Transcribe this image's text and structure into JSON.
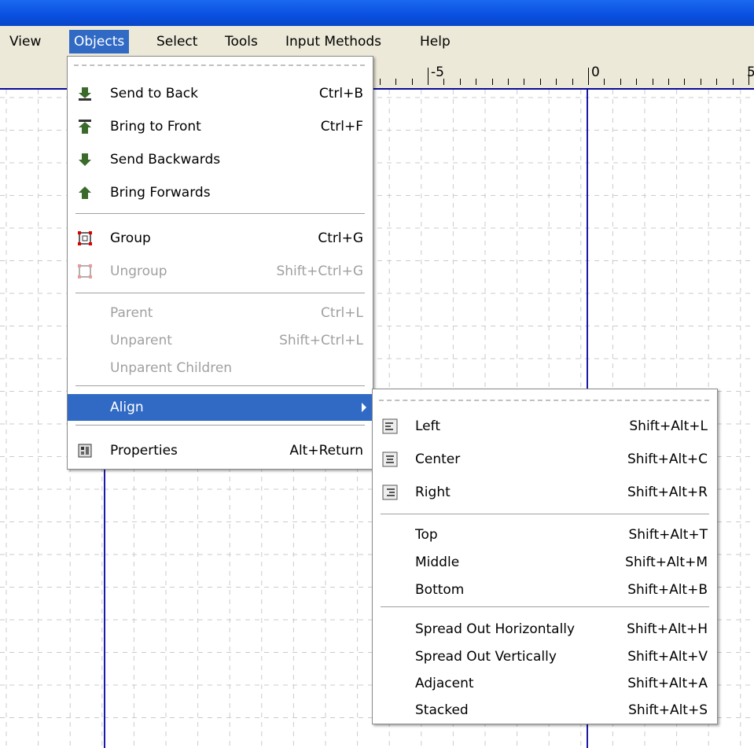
{
  "menubar": {
    "items": [
      {
        "label": "View"
      },
      {
        "label": "Objects"
      },
      {
        "label": "Select"
      },
      {
        "label": "Tools"
      },
      {
        "label": "Input Methods"
      },
      {
        "label": "Help"
      }
    ]
  },
  "ruler": {
    "labels": [
      "-5",
      "0",
      "5"
    ]
  },
  "objects_menu": {
    "items": [
      {
        "label": "Send to Back",
        "shortcut": "Ctrl+B",
        "icon": "send-to-back-icon"
      },
      {
        "label": "Bring to Front",
        "shortcut": "Ctrl+F",
        "icon": "bring-to-front-icon"
      },
      {
        "label": "Send Backwards",
        "shortcut": "",
        "icon": "send-backwards-icon"
      },
      {
        "label": "Bring Forwards",
        "shortcut": "",
        "icon": "bring-forwards-icon"
      },
      {
        "label": "Group",
        "shortcut": "Ctrl+G",
        "icon": "group-icon"
      },
      {
        "label": "Ungroup",
        "shortcut": "Shift+Ctrl+G",
        "icon": "ungroup-icon"
      },
      {
        "label": "Parent",
        "shortcut": "Ctrl+L"
      },
      {
        "label": "Unparent",
        "shortcut": "Shift+Ctrl+L"
      },
      {
        "label": "Unparent Children",
        "shortcut": ""
      },
      {
        "label": "Align",
        "shortcut": ""
      },
      {
        "label": "Properties",
        "shortcut": "Alt+Return",
        "icon": "properties-icon"
      }
    ]
  },
  "align_menu": {
    "items": [
      {
        "label": "Left",
        "shortcut": "Shift+Alt+L",
        "icon": "align-left-icon"
      },
      {
        "label": "Center",
        "shortcut": "Shift+Alt+C",
        "icon": "align-center-icon"
      },
      {
        "label": "Right",
        "shortcut": "Shift+Alt+R",
        "icon": "align-right-icon"
      },
      {
        "label": "Top",
        "shortcut": "Shift+Alt+T"
      },
      {
        "label": "Middle",
        "shortcut": "Shift+Alt+M"
      },
      {
        "label": "Bottom",
        "shortcut": "Shift+Alt+B"
      },
      {
        "label": "Spread Out Horizontally",
        "shortcut": "Shift+Alt+H"
      },
      {
        "label": "Spread Out Vertically",
        "shortcut": "Shift+Alt+V"
      },
      {
        "label": "Adjacent",
        "shortcut": "Shift+Alt+A"
      },
      {
        "label": "Stacked",
        "shortcut": "Shift+Alt+S"
      }
    ]
  },
  "colors": {
    "titlebar": "#0a4fe0",
    "highlight": "#316ac5",
    "menubar": "#ece9d8",
    "guide": "#1a1aa8"
  }
}
